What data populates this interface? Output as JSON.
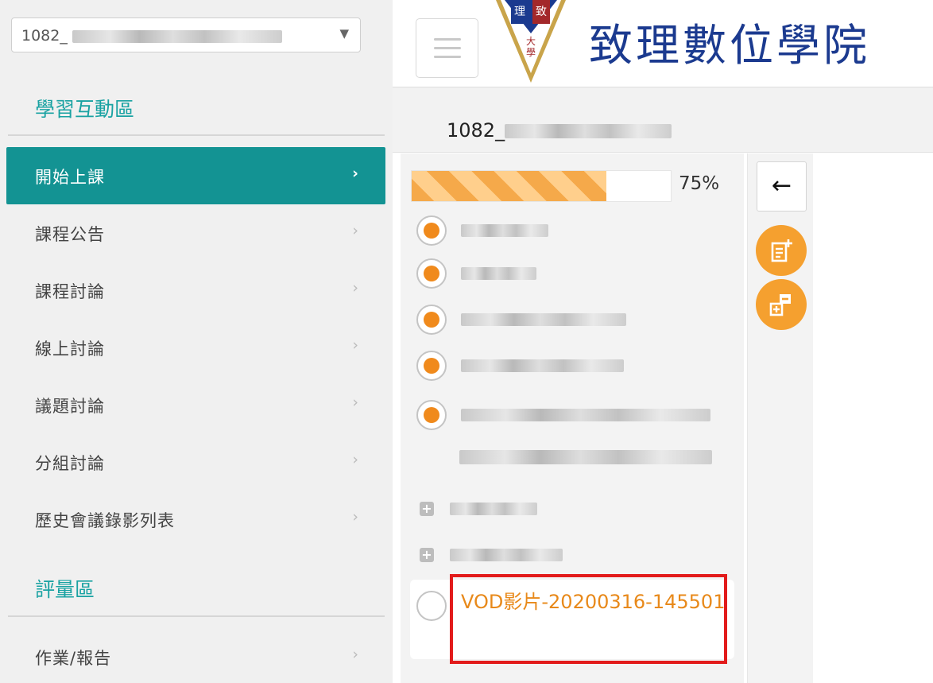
{
  "sidebar": {
    "course_select": {
      "value": "1082_"
    },
    "sections": [
      {
        "title": "學習互動區"
      },
      {
        "title": "評量區"
      }
    ],
    "interaction_items": [
      {
        "label": "開始上課",
        "active": true
      },
      {
        "label": "課程公告",
        "active": false
      },
      {
        "label": "課程討論",
        "active": false
      },
      {
        "label": "線上討論",
        "active": false
      },
      {
        "label": "議題討論",
        "active": false
      },
      {
        "label": "分組討論",
        "active": false
      },
      {
        "label": "歷史會議錄影列表",
        "active": false
      }
    ],
    "assessment_items": [
      {
        "label": "作業/報告",
        "active": false
      }
    ],
    "chevron": "›",
    "caret": "▼"
  },
  "header": {
    "brand": "致理數位學院",
    "logo_seal_text": "理致大學",
    "menu_icon": "hamburger-icon"
  },
  "breadcrumb": {
    "course": "1082_"
  },
  "course_tree": {
    "progress_percent": 75,
    "progress_label": "75%",
    "selected_item": {
      "title": "VOD影片-20200316-145501",
      "status": "unread"
    },
    "colors": {
      "accent": "#139393",
      "progress": "#f5a94a",
      "radio_on": "#f08a1c",
      "vod_text": "#e8891a",
      "highlight": "#e21b1b"
    }
  },
  "tools": {
    "back_glyph": "←",
    "icons": [
      "back-arrow-icon",
      "add-note-icon",
      "add-remove-icon"
    ]
  }
}
